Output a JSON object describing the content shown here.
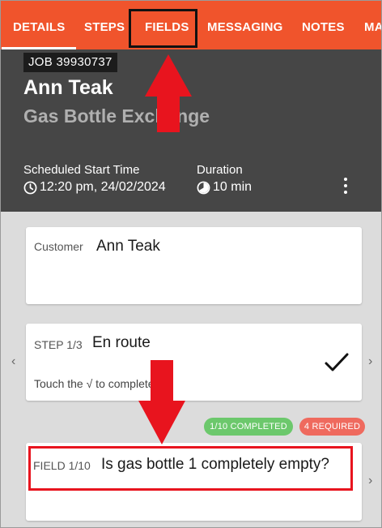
{
  "tabs": [
    {
      "label": "DETAILS",
      "active": true
    },
    {
      "label": "STEPS"
    },
    {
      "label": "FIELDS"
    },
    {
      "label": "MESSAGING"
    },
    {
      "label": "NOTES"
    },
    {
      "label": "MA"
    }
  ],
  "job": {
    "badge": "JOB 39930737",
    "customer_name": "Ann Teak",
    "title": "Gas Bottle Exchange",
    "scheduled_label": "Scheduled Start Time",
    "scheduled_value": "12:20 pm, 24/02/2024",
    "duration_label": "Duration",
    "duration_value": "10 min"
  },
  "customer_card": {
    "label": "Customer",
    "value": "Ann Teak"
  },
  "step_card": {
    "label": "STEP 1/3",
    "value": "En route",
    "hint": "Touch the √ to complete"
  },
  "badges": {
    "completed": "1/10 COMPLETED",
    "required": "4 REQUIRED"
  },
  "field_card": {
    "label": "FIELD 1/10",
    "value": "Is gas bottle 1 completely empty?"
  },
  "colors": {
    "accent": "#f0542c",
    "header_bg": "#464646",
    "completed_badge": "#6cc86c",
    "required_badge": "#ef6a5e",
    "annotation_red": "#e8141e"
  },
  "icons": [
    "clock-icon",
    "timer-icon",
    "kebab-menu-icon",
    "checkmark-icon",
    "chevron-left-icon",
    "chevron-right-icon"
  ]
}
